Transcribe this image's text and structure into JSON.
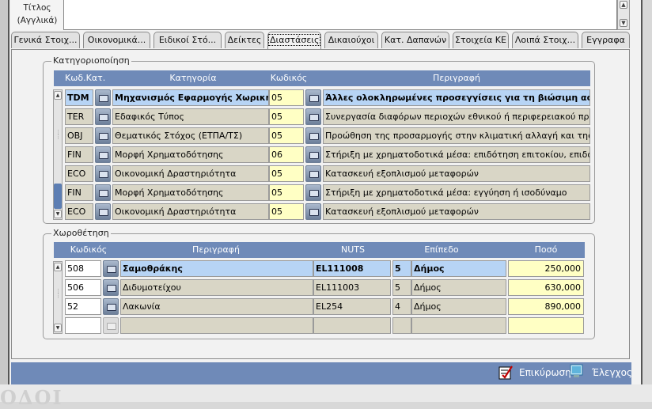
{
  "title_field": {
    "label": "Τίτλος (Αγγλικά)",
    "value": ""
  },
  "tabs": [
    {
      "label": "Γενικά Στοιχ..."
    },
    {
      "label": "Οικονομικά..."
    },
    {
      "label": "Ειδικοί Στό..."
    },
    {
      "label": "Δείκτες"
    },
    {
      "label": "Διαστάσεις",
      "active": true
    },
    {
      "label": "Δικαιούχοι"
    },
    {
      "label": "Κατ. Δαπανών"
    },
    {
      "label": "Στοιχεία ΚΕ"
    },
    {
      "label": "Λοιπά Στοιχ..."
    },
    {
      "label": "Εγγραφα"
    }
  ],
  "categorization": {
    "title": "Κατηγοριοποίηση",
    "headers": {
      "code_cat": "Κωδ.Κατ.",
      "category": "Κατηγορία",
      "code": "Κωδικός",
      "description": "Περιγραφή"
    },
    "rows": [
      {
        "code_cat": "TDM",
        "category": "Μηχανισμός Εφαρμογής Χωρικής Π",
        "code": "05",
        "description": "Άλλες ολοκληρωμένες προσεγγίσεις για τη βιώσιμη αστική ανάπτυξη"
      },
      {
        "code_cat": "TER",
        "category": "Εδαφικός Τύπος",
        "code": "05",
        "description": "Συνεργασία διαφόρων περιοχών εθνικού ή περιφερειακού προγράμματος"
      },
      {
        "code_cat": "OBJ",
        "category": "Θεματικός Στόχος (ΕΤΠΑ/ΤΣ)",
        "code": "05",
        "description": "Προώθηση της προσαρμογής στην κλιματική αλλαγή και της πρόληψης"
      },
      {
        "code_cat": "FIN",
        "category": "Μορφή Χρηματοδότησης",
        "code": "06",
        "description": "Στήριξη με χρηματοδοτικά μέσα: επιδότηση επιτοκίου, επιδότηση"
      },
      {
        "code_cat": "ECO",
        "category": "Οικονομική Δραστηριότητα",
        "code": "05",
        "description": "Κατασκευή εξοπλισμού μεταφορών"
      },
      {
        "code_cat": "FIN",
        "category": "Μορφή Χρηματοδότησης",
        "code": "05",
        "description": "Στήριξη με χρηματοδοτικά μέσα: εγγύηση ή ισοδύναμο"
      },
      {
        "code_cat": "ECO",
        "category": "Οικονομική Δραστηριότητα",
        "code": "05",
        "description": "Κατασκευή εξοπλισμού μεταφορών"
      }
    ]
  },
  "location": {
    "title": "Χωροθέτηση",
    "headers": {
      "code": "Κωδικός",
      "description": "Περιγραφή",
      "nuts": "NUTS",
      "level": "Επίπεδο",
      "amount": "Ποσό"
    },
    "rows": [
      {
        "code": "508",
        "description": "Σαμοθράκης",
        "nuts": "EL111008",
        "level_num": "5",
        "level": "Δήμος",
        "amount": "250,000"
      },
      {
        "code": "506",
        "description": "Διδυμοτείχου",
        "nuts": "EL111003",
        "level_num": "5",
        "level": "Δήμος",
        "amount": "630,000"
      },
      {
        "code": "52",
        "description": "Λακωνία",
        "nuts": "EL254",
        "level_num": "4",
        "level": "Δήμος",
        "amount": "890,000"
      },
      {
        "code": "",
        "description": "",
        "nuts": "",
        "level_num": "",
        "level": "",
        "amount": ""
      }
    ]
  },
  "status_bar": {
    "confirm_label": "Επικύρωση",
    "check_label": "Έλεγχος"
  },
  "colors": {
    "header_blue": "#6f8ab8",
    "selected_row": "#b7d4f5",
    "input_yellow": "#ffffc4",
    "readonly_beige": "#d9d6c6"
  }
}
